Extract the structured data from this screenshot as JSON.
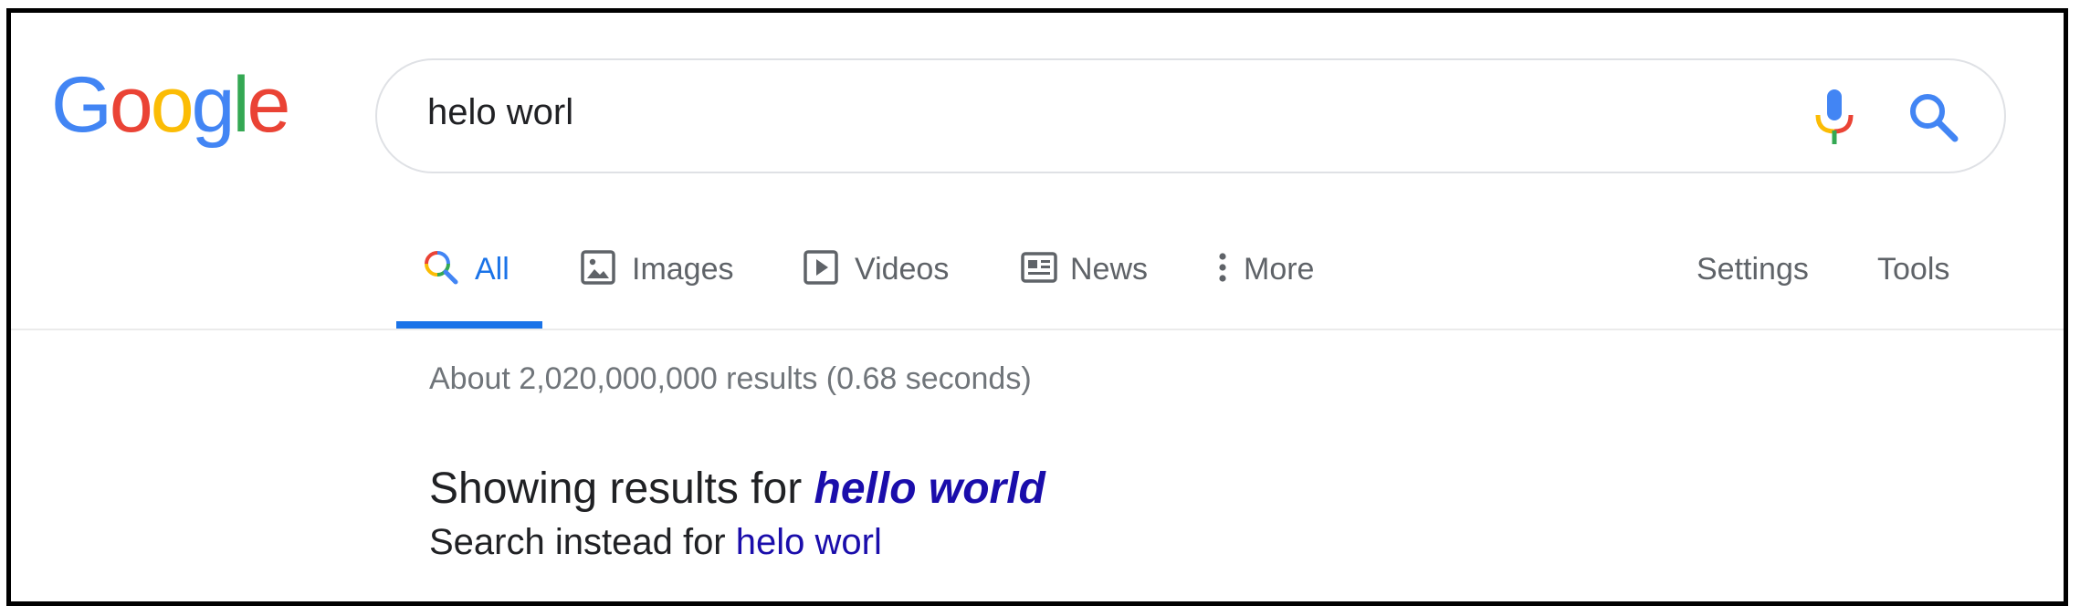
{
  "logo": {
    "letters": [
      "G",
      "o",
      "o",
      "g",
      "l",
      "e"
    ],
    "colors": [
      "#4285F4",
      "#EA4335",
      "#FBBC05",
      "#4285F4",
      "#34A853",
      "#EA4335"
    ]
  },
  "search": {
    "query": "helo worl"
  },
  "tabs": [
    {
      "label": "All",
      "icon": "search-multicolor-icon",
      "active": true
    },
    {
      "label": "Images",
      "icon": "image-icon",
      "active": false
    },
    {
      "label": "Videos",
      "icon": "play-icon",
      "active": false
    },
    {
      "label": "News",
      "icon": "newspaper-icon",
      "active": false
    },
    {
      "label": "More",
      "icon": "more-vert-icon",
      "active": false
    }
  ],
  "tools": {
    "settings_label": "Settings",
    "tools_label": "Tools"
  },
  "results": {
    "stats": "About 2,020,000,000 results (0.68 seconds)",
    "showing_prefix": "Showing results for ",
    "corrected_query": "hello world",
    "instead_prefix": "Search instead for ",
    "original_query": "helo worl"
  },
  "colors": {
    "accent": "#1a73e8",
    "link": "#1a0dab",
    "muted": "#70757a",
    "tab_text": "#5f6368"
  }
}
